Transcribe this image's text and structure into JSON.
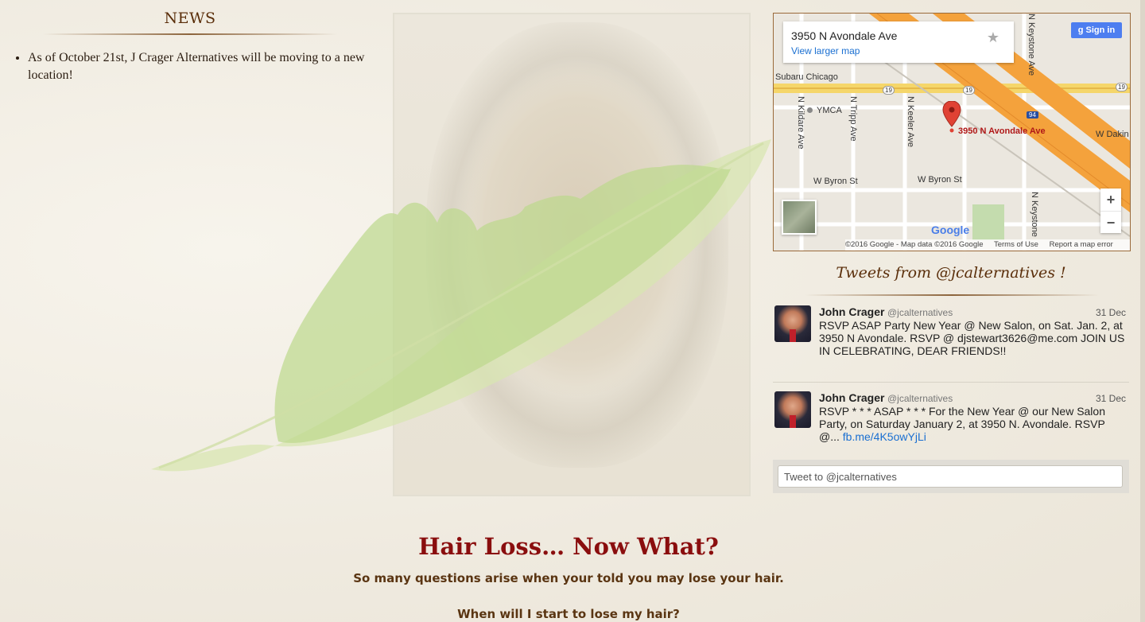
{
  "news": {
    "title": "NEWS",
    "items": [
      "As of October 21st, J Crager Alternatives will be moving to a new location!"
    ]
  },
  "map": {
    "address": "3950 N Avondale Ave",
    "view_larger": "View larger map",
    "sign_in": "Sign in",
    "marker_label": "3950 N Avondale Ave",
    "labels": {
      "subaru": "Subaru Chicago",
      "ymca": "YMCA",
      "kildare": "N Kildare Ave",
      "tripp": "N Tripp Ave",
      "keeler": "N Keeler Ave",
      "keystone1": "N Keystone Ave",
      "keystone2": "N Keystone",
      "byron1": "W Byron St",
      "byron2": "W Byron St",
      "dakin": "W Dakin",
      "hwy19a": "19",
      "hwy19b": "19",
      "hwy19c": "19",
      "i94": "94"
    },
    "zoom_in": "+",
    "zoom_out": "−",
    "google": "Google",
    "footer": {
      "copyright": "©2016 Google - Map data ©2016 Google",
      "terms": "Terms of Use",
      "report": "Report a map error"
    }
  },
  "tweets": {
    "title": "Tweets from @jcalternatives !",
    "items": [
      {
        "name": "John Crager",
        "handle": "@jcalternatives",
        "date": "31 Dec",
        "text": "RSVP ASAP Party New Year @ New Salon, on Sat. Jan. 2, at 3950 N Avondale. RSVP @ djstewart3626@me.com JOIN US IN CELEBRATING, DEAR FRIENDS!!"
      },
      {
        "name": "John Crager",
        "handle": "@jcalternatives",
        "date": "31 Dec",
        "text": "RSVP * * * ASAP * * * For the New Year @ our New Salon Party, on Saturday January 2, at 3950 N. Avondale. RSVP @... ",
        "link": "fb.me/4K5owYjLi"
      }
    ],
    "tweet_to": "Tweet to @jcalternatives"
  },
  "main": {
    "headline": "Hair Loss… Now What?",
    "subheadline": "So many questions arise when your told you may lose your hair.",
    "question": "When will I start to lose my hair?"
  }
}
